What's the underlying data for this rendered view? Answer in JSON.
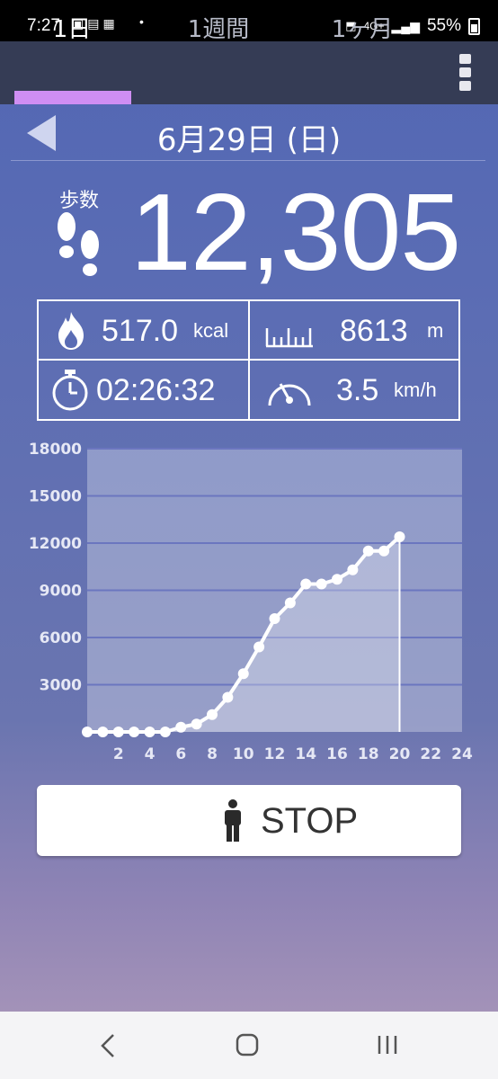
{
  "status_bar": {
    "time": "7:27",
    "notif_icons": [
      "tv-icon",
      "news-icon",
      "edit-icon"
    ],
    "dot": "•",
    "network": "4G+",
    "battery": "55%"
  },
  "tabs": [
    {
      "label": "1日",
      "active": true
    },
    {
      "label": "1週間",
      "active": false
    },
    {
      "label": "1ヶ月",
      "active": false
    }
  ],
  "date": "6月29日 (日)",
  "steps": {
    "label": "歩数",
    "value": "12,305"
  },
  "stats": {
    "calories": {
      "value": "517.0",
      "unit": "kcal"
    },
    "distance": {
      "value": "8613",
      "unit": "m"
    },
    "duration": {
      "value": "02:26:32"
    },
    "speed": {
      "value": "3.5",
      "unit": "km/h"
    }
  },
  "chart_data": {
    "type": "line",
    "x": [
      0,
      1,
      2,
      3,
      4,
      5,
      6,
      7,
      8,
      9,
      10,
      11,
      12,
      13,
      14,
      15,
      16,
      17,
      18,
      19,
      20
    ],
    "values": [
      0,
      0,
      0,
      0,
      0,
      0,
      300,
      500,
      1100,
      2200,
      3700,
      5400,
      7200,
      8200,
      9400,
      9400,
      9700,
      10300,
      11500,
      11500,
      12400
    ],
    "ylim": [
      0,
      18000
    ],
    "xlim": [
      0,
      24
    ],
    "yticks": [
      3000,
      6000,
      9000,
      12000,
      15000,
      18000
    ],
    "xticks": [
      2,
      4,
      6,
      8,
      10,
      12,
      14,
      16,
      18,
      20,
      22,
      24
    ],
    "grid": true
  },
  "stop_button": {
    "label": "STOP"
  },
  "colors": {
    "tab_accent": "#cf8ef3",
    "tabbar": "#353c55",
    "grid": "#6b76bf"
  }
}
